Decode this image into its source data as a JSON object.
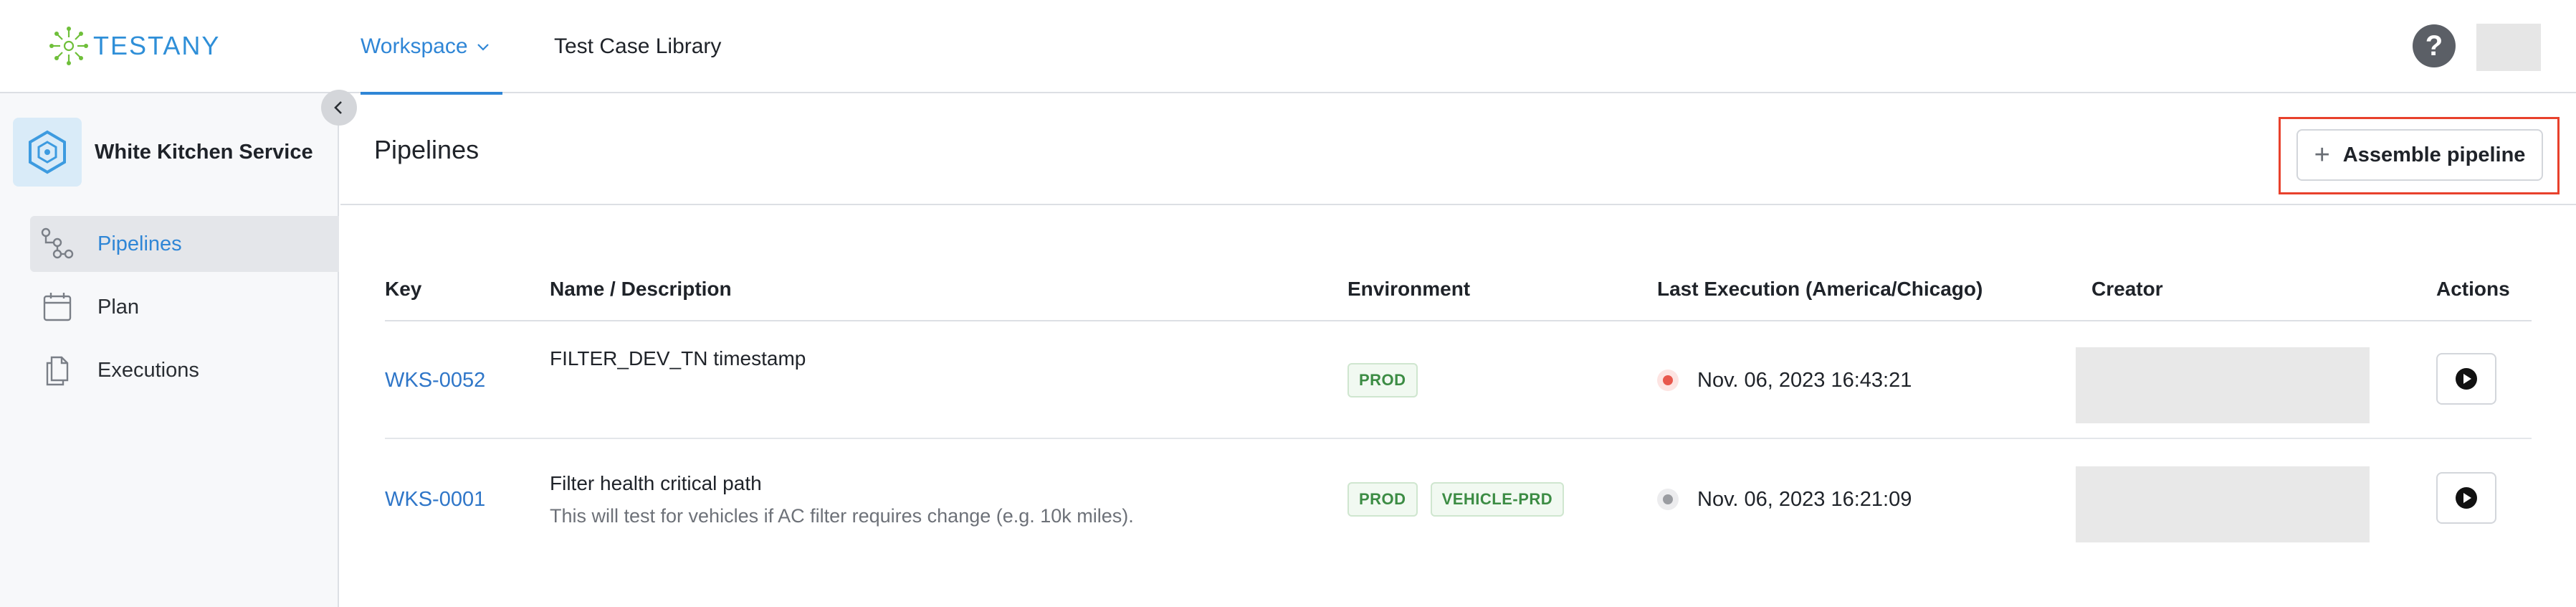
{
  "header": {
    "logo_text": "TESTANY",
    "nav": {
      "workspace": "Workspace",
      "library": "Test Case Library"
    },
    "help_glyph": "?",
    "brand_color": "#2f8fd8"
  },
  "sidebar": {
    "project_name": "White Kitchen Service",
    "items": [
      {
        "label": "Pipelines",
        "icon": "pipeline-icon",
        "active": true
      },
      {
        "label": "Plan",
        "icon": "calendar-icon",
        "active": false
      },
      {
        "label": "Executions",
        "icon": "copy-files-icon",
        "active": false
      }
    ]
  },
  "main": {
    "title": "Pipelines",
    "assemble_button": "Assemble pipeline",
    "table": {
      "columns": [
        "Key",
        "Name / Description",
        "Environment",
        "Last Execution (America/Chicago)",
        "Creator",
        "Actions"
      ],
      "rows": [
        {
          "key": "WKS-0052",
          "name": "FILTER_DEV_TN timestamp",
          "description": "",
          "environments": [
            "PROD"
          ],
          "status_color": "#e8584d",
          "status_halo": "#fde4e2",
          "last_execution": "Nov. 06, 2023 16:43:21"
        },
        {
          "key": "WKS-0001",
          "name": "Filter health critical path",
          "description": "This will test for vehicles if AC filter requires change (e.g. 10k miles).",
          "environments": [
            "PROD",
            "VEHICLE-PRD"
          ],
          "status_color": "#9a9ca1",
          "status_halo": "#ececee",
          "last_execution": "Nov. 06, 2023 16:21:09"
        }
      ]
    }
  },
  "colors": {
    "accent": "#2f86d6",
    "highlight": "#e8412c"
  }
}
